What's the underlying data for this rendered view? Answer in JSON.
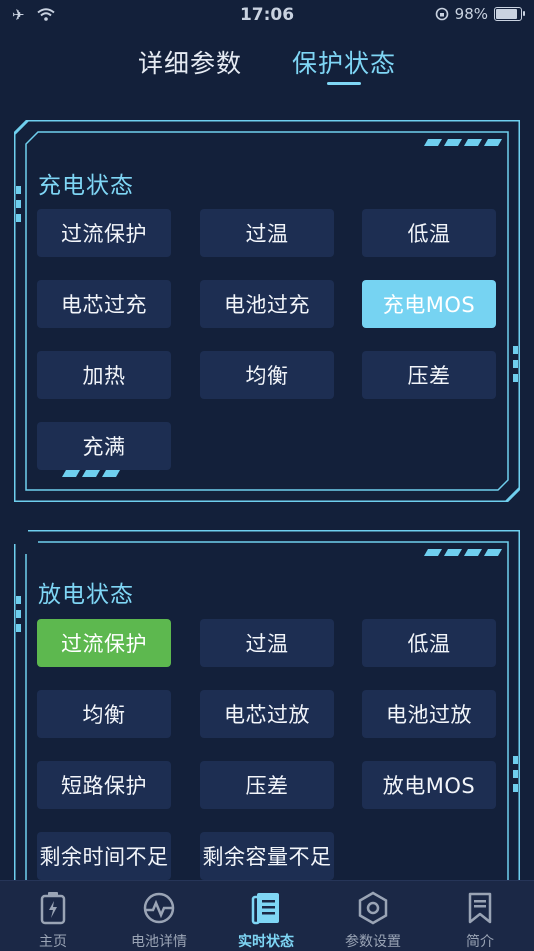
{
  "status_bar": {
    "time": "17:06",
    "battery_text": "98%",
    "icons": [
      "airplane-icon",
      "wifi-icon",
      "orientation-lock-icon",
      "battery-icon"
    ]
  },
  "top_tabs": [
    {
      "label": "详细参数",
      "active": false
    },
    {
      "label": "保护状态",
      "active": true
    }
  ],
  "charge_panel": {
    "title": "充电状态",
    "chips": [
      {
        "label": "过流保护",
        "state": "off"
      },
      {
        "label": "过温",
        "state": "off"
      },
      {
        "label": "低温",
        "state": "off"
      },
      {
        "label": "电芯过充",
        "state": "off"
      },
      {
        "label": "电池过充",
        "state": "off"
      },
      {
        "label": "充电MOS",
        "state": "on"
      },
      {
        "label": "加热",
        "state": "off"
      },
      {
        "label": "均衡",
        "state": "off"
      },
      {
        "label": "压差",
        "state": "off"
      },
      {
        "label": "充满",
        "state": "off"
      }
    ]
  },
  "discharge_panel": {
    "title": "放电状态",
    "chips": [
      {
        "label": "过流保护",
        "state": "alarm"
      },
      {
        "label": "过温",
        "state": "off"
      },
      {
        "label": "低温",
        "state": "off"
      },
      {
        "label": "均衡",
        "state": "off"
      },
      {
        "label": "电芯过放",
        "state": "off"
      },
      {
        "label": "电池过放",
        "state": "off"
      },
      {
        "label": "短路保护",
        "state": "off"
      },
      {
        "label": "压差",
        "state": "off"
      },
      {
        "label": "放电MOS",
        "state": "off"
      },
      {
        "label": "剩余时间不足",
        "state": "off"
      },
      {
        "label": "剩余容量不足",
        "state": "off"
      }
    ]
  },
  "colors": {
    "background": "#13203a",
    "accent": "#7fd6f5",
    "chip_off": "#1d2e52",
    "chip_on": "#76d3f2",
    "chip_alarm": "#5db84f"
  },
  "bottom_nav": [
    {
      "label": "主页",
      "icon": "battery-icon",
      "active": false
    },
    {
      "label": "电池详情",
      "icon": "pulse-gauge-icon",
      "active": false
    },
    {
      "label": "实时状态",
      "icon": "document-list-icon",
      "active": true
    },
    {
      "label": "参数设置",
      "icon": "hex-settings-icon",
      "active": false
    },
    {
      "label": "简介",
      "icon": "bookmark-icon",
      "active": false
    }
  ]
}
